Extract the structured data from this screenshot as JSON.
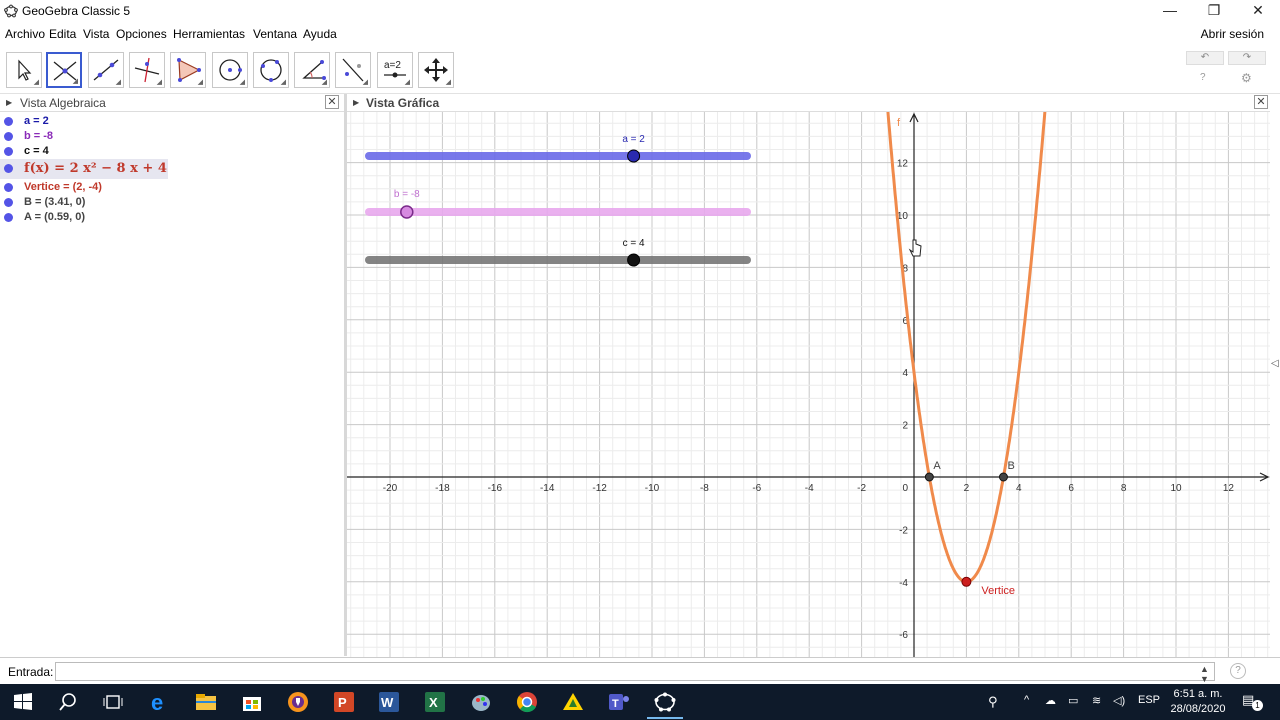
{
  "window": {
    "title": "GeoGebra Classic 5",
    "minimize": "—",
    "maximize": "❐",
    "close": "✕"
  },
  "menu": {
    "items": [
      "Archivo",
      "Edita",
      "Vista",
      "Opciones",
      "Herramientas",
      "Ventana",
      "Ayuda"
    ],
    "login": "Abrir sesión"
  },
  "toolbar": {
    "undo": "↶",
    "redo": "↷",
    "help": "?",
    "settings": "⚙",
    "tool_labels": [
      "move-tool",
      "point-intersect-tool",
      "line-tool",
      "perpendicular-tool",
      "polygon-tool",
      "circle-tool",
      "conic-tool",
      "angle-tool",
      "reflect-tool",
      "slider-tool",
      "move-view-tool"
    ],
    "slider_tool_text": "a=2"
  },
  "algebra": {
    "title": "Vista Algebraica",
    "close": "✕",
    "items": [
      {
        "text": "a = 2",
        "color": "#1a1aa8",
        "dot": "#5454e6"
      },
      {
        "text": "b = -8",
        "color": "#8a2bb8",
        "dot": "#5454e6"
      },
      {
        "text": "c = 4",
        "color": "#111111",
        "dot": "#5454e6"
      },
      {
        "text": "f(x) = 2 x² − 8 x + 4",
        "color": "#c0392b",
        "dot": "#5454e6"
      },
      {
        "text": "Vertice = (2, -4)",
        "color": "#c0392b",
        "dot": "#5454e6"
      },
      {
        "text": "B = (3.41, 0)",
        "color": "#444444",
        "dot": "#5454e6"
      },
      {
        "text": "A = (0.59, 0)",
        "color": "#444444",
        "dot": "#5454e6"
      }
    ]
  },
  "graphics": {
    "title": "Vista Gráfica",
    "close": "✕",
    "sliders": [
      {
        "label": "a = 2",
        "value": 2,
        "min": -5,
        "max": 5,
        "color": "#6a6ae8",
        "text_color": "#2a2ab0"
      },
      {
        "label": "b = -8",
        "value": -8,
        "min": -10,
        "max": 10,
        "color": "#e8a8ee",
        "text_color": "#c070d0"
      },
      {
        "label": "c = 4",
        "value": 4,
        "min": -10,
        "max": 10,
        "color": "#777777",
        "text_color": "#111111"
      }
    ],
    "function_label": "f",
    "point_labels": {
      "A": "A",
      "B": "B",
      "Vertice": "Vertice"
    },
    "x_ticks": [
      "-20",
      "-18",
      "-16",
      "-14",
      "-12",
      "-10",
      "-8",
      "-6",
      "-4",
      "-2",
      "2",
      "4",
      "6",
      "8",
      "10",
      "12"
    ],
    "y_ticks": [
      "12",
      "10",
      "8",
      "6",
      "4",
      "2",
      "-2",
      "-4",
      "-6"
    ],
    "origin_label": "0",
    "curve_color": "#f08a4b",
    "vertex_color": "#cc1f1f"
  },
  "input": {
    "label": "Entrada:",
    "value": "",
    "help": "?"
  },
  "taskbar": {
    "lang": "ESP",
    "time": "6:51 a. m.",
    "date": "28/08/2020",
    "notification_count": "1"
  }
}
